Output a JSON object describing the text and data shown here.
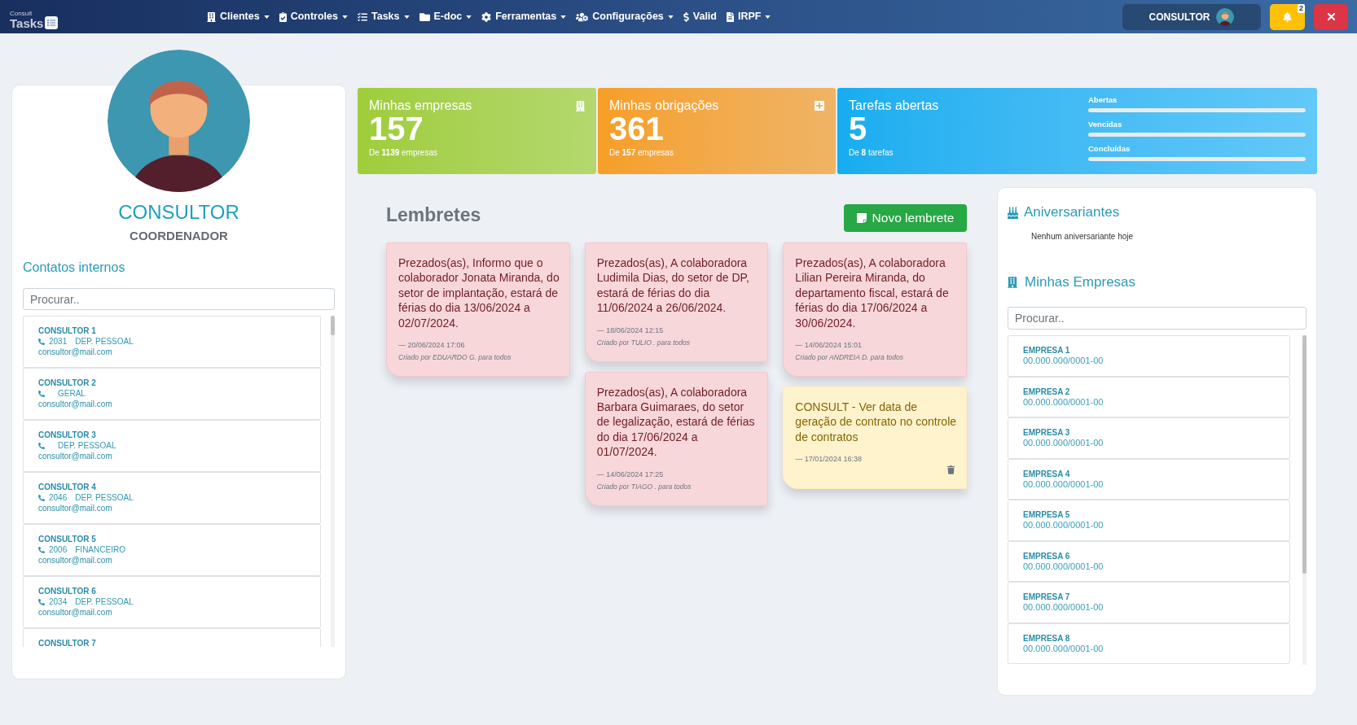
{
  "navbar": {
    "logo": {
      "subtitle": "Consult",
      "text": "Tasks"
    },
    "menu": [
      {
        "label": "Clientes",
        "dropdown": true
      },
      {
        "label": "Controles",
        "dropdown": true
      },
      {
        "label": "Tasks",
        "dropdown": true
      },
      {
        "label": "E-doc",
        "dropdown": true
      },
      {
        "label": "Ferramentas",
        "dropdown": true
      },
      {
        "label": "Configurações",
        "dropdown": true
      },
      {
        "label": "Valid",
        "dropdown": false
      },
      {
        "label": "IRPF",
        "dropdown": true
      }
    ],
    "user": {
      "name": "CONSULTOR"
    },
    "notifications": {
      "badge": "2"
    }
  },
  "profile": {
    "name": "CONSULTOR",
    "role": "COORDENADOR"
  },
  "contacts": {
    "title": "Contatos internos",
    "search": {
      "placeholder": "Procurar.."
    },
    "items": [
      {
        "name": "CONSULTOR 1",
        "extension": "2031",
        "department": "DEP. PESSOAL",
        "email": "consultor@mail.com"
      },
      {
        "name": "CONSULTOR 2",
        "department": "GERAL",
        "email": "consultor@mail.com"
      },
      {
        "name": "CONSULTOR 3",
        "department": "DEP. PESSOAL",
        "email": "consultor@mail.com"
      },
      {
        "name": "CONSULTOR 4",
        "extension": "2046",
        "department": "DEP. PESSOAL",
        "email": "consultor@mail.com"
      },
      {
        "name": "CONSULTOR 5",
        "extension": "2006",
        "department": "FINANCEIRO",
        "email": "consultor@mail.com"
      },
      {
        "name": "CONSULTOR 6",
        "extension": "2034",
        "department": "DEP. PESSOAL",
        "email": "consultor@mail.com"
      },
      {
        "name": "CONSULTOR 7"
      }
    ]
  },
  "stats": [
    {
      "kind": "icon",
      "title": "Minhas empresas",
      "value": "157",
      "subtitle": "De **1139** empresas"
    },
    {
      "kind": "icon",
      "title": "Minhas obrigações",
      "value": "361",
      "subtitle": "De **157** empresas"
    },
    {
      "kind": "meters",
      "title": "Tarefas abertas",
      "value": "5",
      "subtitle": "De **8** tarefas",
      "meters": [
        {
          "label": "Abertas",
          "level": 1
        },
        {
          "label": "Vencidas",
          "level": 1
        },
        {
          "label": "Concluídas",
          "level": 1
        }
      ]
    }
  ],
  "reminders": {
    "title": "Lembretes",
    "new_button": "Novo lembrete",
    "columns": [
      [
        {
          "kind": "danger",
          "text": "Prezados(as), Informo que o colaborador Jonata Miranda, do setor de implantação, estará de férias do dia 13/06/2024 a 02/07/2024.",
          "date": "— 20/06/2024 17:06",
          "author": "Criado por EDUARDO G. para todos",
          "deletable": false
        }
      ],
      [
        {
          "kind": "danger",
          "text": "Prezados(as), A colaboradora Ludimila Dias, do setor de DP, estará de férias do dia 11/06/2024 a 26/06/2024.",
          "date": "— 18/06/2024 12:15",
          "author": "Criado por TULIO . para todos",
          "deletable": false
        },
        {
          "kind": "danger",
          "text": "Prezados(as), A colaboradora Barbara Guimaraes, do setor de legalização, estará de férias do dia 17/06/2024 a 01/07/2024.",
          "date": "— 14/06/2024 17:25",
          "author": "Criado por TIAGO . para todos",
          "deletable": false
        }
      ],
      [
        {
          "kind": "danger",
          "text": "Prezados(as), A colaboradora Lilian Pereira Miranda, do departamento fiscal, estará de férias do dia 17/06/2024 a 30/06/2024.",
          "date": "— 14/06/2024 15:01",
          "author": "Criado por ANDREIA D. para todos",
          "deletable": false
        },
        {
          "kind": "warning",
          "text": "CONSULT - Ver data de geração de contrato no controle de contratos",
          "date": "— 17/01/2024 16:38",
          "deletable": true
        }
      ]
    ]
  },
  "birthdays": {
    "title": "Aniversariantes",
    "empty_text": "Nenhum aniversariante hoje"
  },
  "companies": {
    "title": "Minhas Empresas",
    "search": {
      "placeholder": "Procurar.."
    },
    "items": [
      {
        "name": "EMPRESA 1",
        "cnpj": "00.000.000/0001-00"
      },
      {
        "name": "EMPRESA 2",
        "cnpj": "00.000.000/0001-00"
      },
      {
        "name": "EMPRESA 3",
        "cnpj": "00.000.000/0001-00"
      },
      {
        "name": "EMPRESA 4",
        "cnpj": "00.000.000/0001-00"
      },
      {
        "name": "EMRPESA 5",
        "cnpj": "00.000.000/0001-00"
      },
      {
        "name": "EMPRESA 6",
        "cnpj": "00.000.000/0001-00"
      },
      {
        "name": "EMPRESA 7",
        "cnpj": "00.000.000/0001-00"
      },
      {
        "name": "EMPRESA 8",
        "cnpj": "00.000.000/0001-00"
      }
    ]
  }
}
